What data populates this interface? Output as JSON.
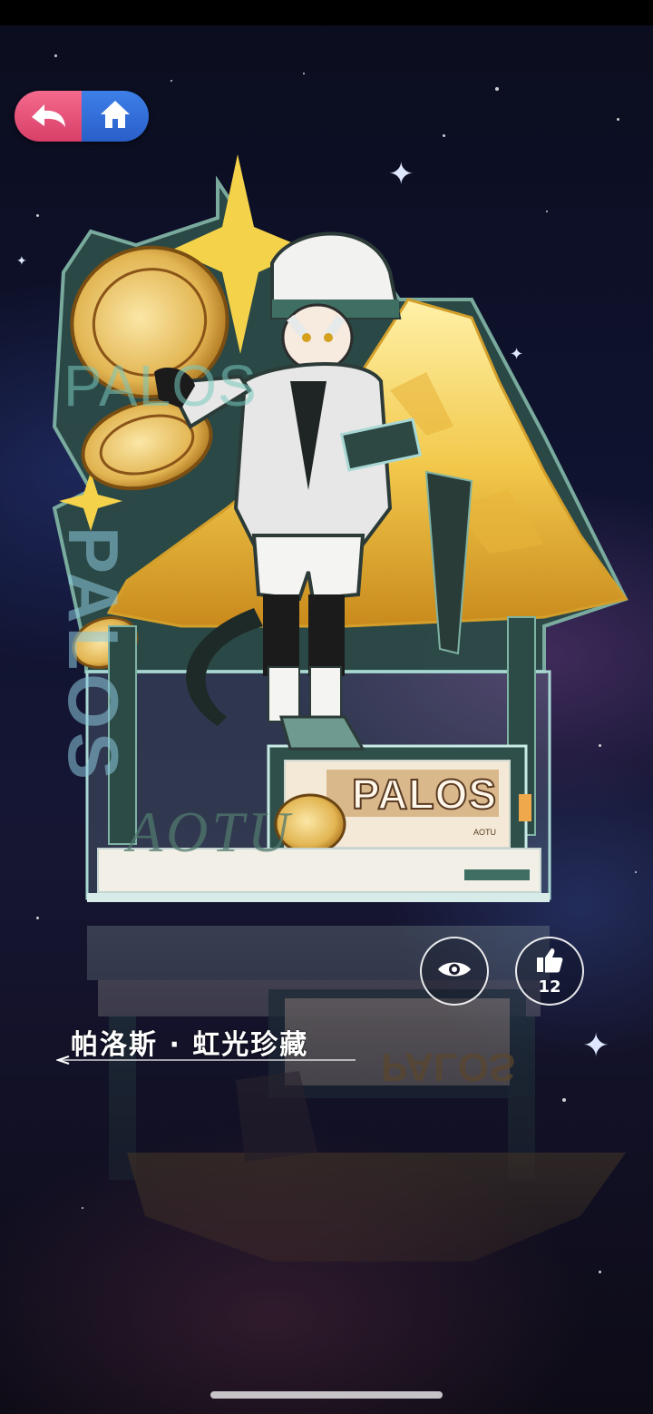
{
  "nav": {
    "back_icon": "back-arrow-icon",
    "home_icon": "home-icon"
  },
  "artwork": {
    "brand_vertical": "PALOS",
    "brand_faint": "PALOS",
    "signature": "AOTU",
    "nameplate": "PALOS",
    "nameplate_sub": "AOTU"
  },
  "actions": {
    "view_icon": "eye-icon",
    "like_icon": "thumbs-up-icon",
    "like_count": "12"
  },
  "item": {
    "title": "帕洛斯 · 虹光珍藏"
  },
  "colors": {
    "back_button": "#e9557a",
    "home_button": "#3470dc",
    "gold": "#f2c94c",
    "teal_frame": "#3f6f63"
  }
}
